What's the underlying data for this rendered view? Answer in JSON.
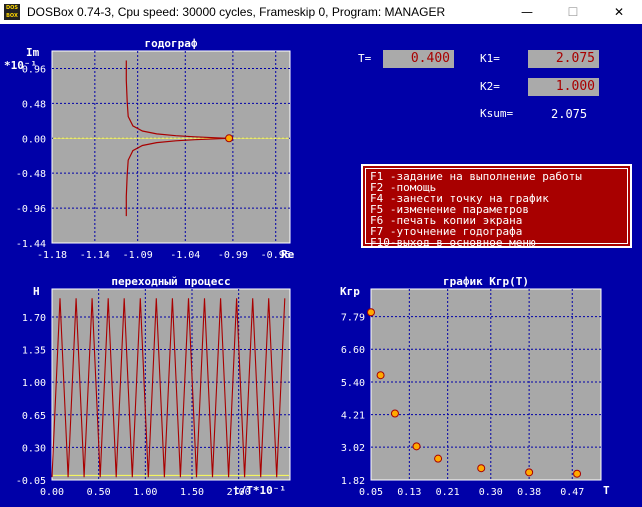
{
  "window": {
    "title": "DOSBox 0.74-3, Cpu speed:    30000 cycles, Frameskip  0, Program:  MANAGER",
    "icon_text": "DOS BOX",
    "minimize": "—",
    "maximize": "☐",
    "close": "✕"
  },
  "params": {
    "t_label": "T=",
    "t_value": "0.400",
    "k1_label": "K1=",
    "k1_value": "2.075",
    "k2_label": "K2=",
    "k2_value": "1.000",
    "ksum_label": "Ksum=",
    "ksum_value": "2.075"
  },
  "menu": [
    {
      "key": "F1",
      "text": " -задание на выполнение работы"
    },
    {
      "key": "F2",
      "text": " -помощь"
    },
    {
      "key": "F4",
      "text": " -занести точку на график"
    },
    {
      "key": "F5",
      "text": " -изменение параметров"
    },
    {
      "key": "F6",
      "text": " -печать копии экрана"
    },
    {
      "key": "F7",
      "text": " -уточнение годографа"
    },
    {
      "key": "F10",
      "text": "-выход в основное меню"
    }
  ],
  "colors": {
    "plot_bg": "#a8a8a8",
    "screen_bg": "#0000a8",
    "grid": "#0000a8",
    "curve": "#a80000",
    "axis_line": "#ffff55",
    "marker": "#ffaa00"
  },
  "chart_data": [
    {
      "type": "line",
      "title": "годограф",
      "ylabel": "Im",
      "ylabel_unit": "*10⁻¹",
      "xlabel": "Re",
      "xlim": [
        -1.18,
        -0.93
      ],
      "ylim": [
        -1.44,
        1.2
      ],
      "x_ticks": [
        "-1.18",
        "-1.14",
        "-1.09",
        "-1.04",
        "-0.99",
        "-0.95"
      ],
      "x_tick_values": [
        -1.18,
        -1.135,
        -1.09,
        -1.04,
        -0.99,
        -0.945
      ],
      "y_ticks": [
        "0.96",
        "0.48",
        "0.00",
        "-0.48",
        "-0.96",
        "-1.44"
      ],
      "y_tick_values": [
        0.96,
        0.48,
        0.0,
        -0.48,
        -0.96,
        -1.44
      ],
      "series": [
        {
          "x": [
            -1.102,
            -1.102,
            -1.101,
            -1.1,
            -1.095,
            -1.085,
            -1.07,
            -1.05,
            -1.03,
            -1.01,
            -0.995
          ],
          "y": [
            1.07,
            0.8,
            0.5,
            0.3,
            0.17,
            0.1,
            0.06,
            0.035,
            0.02,
            0.008,
            0.0
          ]
        },
        {
          "x": [
            -1.102,
            -1.102,
            -1.101,
            -1.1,
            -1.095,
            -1.085,
            -1.07,
            -1.05,
            -1.03,
            -1.01,
            -0.995
          ],
          "y": [
            -1.07,
            -0.8,
            -0.5,
            -0.3,
            -0.17,
            -0.1,
            -0.06,
            -0.035,
            -0.02,
            -0.008,
            0.0
          ]
        }
      ],
      "markers": [
        {
          "x": -0.994,
          "y": 0.0
        }
      ]
    },
    {
      "type": "line",
      "title": "переходный процесс",
      "ylabel": "H",
      "xlabel": "t/T*10⁻¹",
      "xlim": [
        0.0,
        2.55
      ],
      "ylim": [
        -0.05,
        2.0
      ],
      "x_ticks": [
        "0.00",
        "0.50",
        "1.00",
        "1.50",
        "2.00"
      ],
      "x_tick_values": [
        0.0,
        0.5,
        1.0,
        1.5,
        2.0
      ],
      "y_ticks": [
        "1.70",
        "1.35",
        "1.00",
        "0.65",
        "0.30",
        "-0.05"
      ],
      "y_tick_values": [
        1.7,
        1.35,
        1.0,
        0.65,
        0.3,
        -0.05
      ],
      "series": [
        {
          "period": 0.172,
          "min": -0.02,
          "max": 1.9,
          "x_start": 0.0,
          "x_end": 2.55
        }
      ]
    },
    {
      "type": "scatter",
      "title": "график Kгр(T)",
      "ylabel": "Kгр",
      "xlabel": "T",
      "xlim": [
        0.05,
        0.53
      ],
      "ylim": [
        1.82,
        8.8
      ],
      "x_ticks": [
        "0.05",
        "0.13",
        "0.21",
        "0.30",
        "0.38",
        "0.47"
      ],
      "x_tick_values": [
        0.05,
        0.13,
        0.21,
        0.3,
        0.38,
        0.47
      ],
      "y_ticks": [
        "7.79",
        "6.60",
        "5.40",
        "4.21",
        "3.02",
        "1.82"
      ],
      "y_tick_values": [
        7.79,
        6.6,
        5.4,
        4.21,
        3.02,
        1.82
      ],
      "points": {
        "x": [
          0.05,
          0.07,
          0.1,
          0.145,
          0.19,
          0.28,
          0.38,
          0.48
        ],
        "y": [
          7.95,
          5.65,
          4.25,
          3.05,
          2.6,
          2.25,
          2.1,
          2.05
        ]
      }
    }
  ]
}
